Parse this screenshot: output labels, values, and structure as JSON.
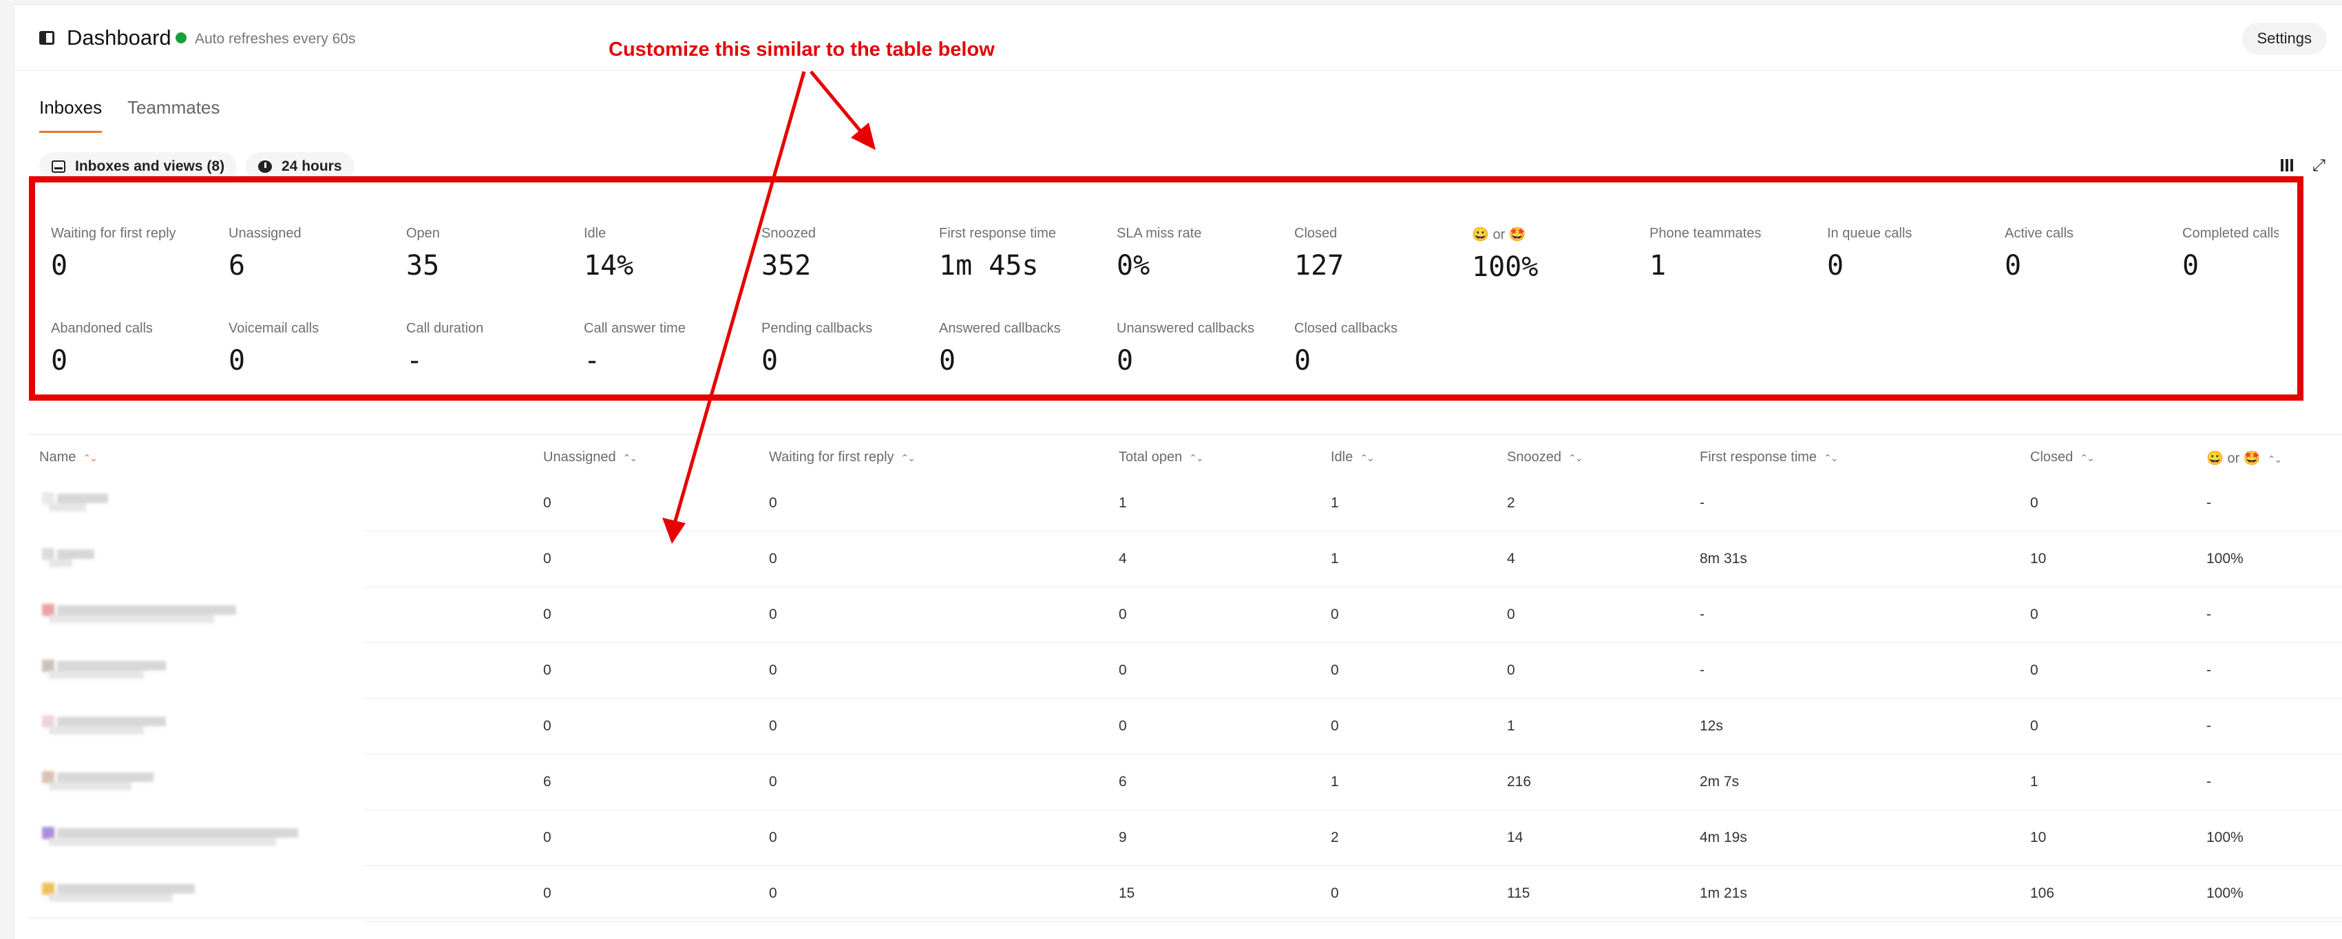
{
  "header": {
    "title": "Dashboard",
    "refresh_note": "Auto refreshes every 60s",
    "settings_label": "Settings"
  },
  "tabs": [
    {
      "label": "Inboxes",
      "active": true
    },
    {
      "label": "Teammates",
      "active": false
    }
  ],
  "filters": {
    "inboxes_label": "Inboxes and views (8)",
    "period_label": "24 hours"
  },
  "annotation": {
    "text": "Customize this similar to the table below",
    "color": "#e60000"
  },
  "metrics": [
    {
      "label": "Waiting for first reply",
      "value": "0"
    },
    {
      "label": "Unassigned",
      "value": "6"
    },
    {
      "label": "Open",
      "value": "35"
    },
    {
      "label": "Idle",
      "value": "14%"
    },
    {
      "label": "Snoozed",
      "value": "352"
    },
    {
      "label": "First response time",
      "value": "1m 45s"
    },
    {
      "label": "SLA miss rate",
      "value": "0%"
    },
    {
      "label": "Closed",
      "value": "127"
    },
    {
      "label": "😀 or 🤩",
      "value": "100%"
    },
    {
      "label": "Phone teammates",
      "value": "1"
    },
    {
      "label": "In queue calls",
      "value": "0"
    },
    {
      "label": "Active calls",
      "value": "0"
    },
    {
      "label": "Completed calls",
      "value": "0"
    },
    {
      "label": "Abandoned calls",
      "value": "0"
    },
    {
      "label": "Voicemail calls",
      "value": "0"
    },
    {
      "label": "Call duration",
      "value": "-"
    },
    {
      "label": "Call answer time",
      "value": "-"
    },
    {
      "label": "Pending callbacks",
      "value": "0"
    },
    {
      "label": "Answered callbacks",
      "value": "0"
    },
    {
      "label": "Unanswered callbacks",
      "value": "0"
    },
    {
      "label": "Closed callbacks",
      "value": "0"
    }
  ],
  "table": {
    "columns": [
      "Name",
      "Unassigned",
      "Waiting for first reply",
      "Total open",
      "Idle",
      "Snoozed",
      "First response time",
      "Closed",
      "😀 or 🤩"
    ],
    "rows": [
      {
        "swatch": "#e9e9e9",
        "cells": [
          "0",
          "0",
          "1",
          "1",
          "2",
          "-",
          "0",
          "-"
        ]
      },
      {
        "swatch": "#dcdcdc",
        "cells": [
          "0",
          "0",
          "4",
          "1",
          "4",
          "8m 31s",
          "10",
          "100%"
        ]
      },
      {
        "swatch": "#e8a4a4",
        "cells": [
          "0",
          "0",
          "0",
          "0",
          "0",
          "-",
          "0",
          "-"
        ]
      },
      {
        "swatch": "#c9c2bb",
        "cells": [
          "0",
          "0",
          "0",
          "0",
          "0",
          "-",
          "0",
          "-"
        ]
      },
      {
        "swatch": "#f2d2d6",
        "cells": [
          "0",
          "0",
          "0",
          "0",
          "1",
          "12s",
          "0",
          "-"
        ]
      },
      {
        "swatch": "#d9c3b6",
        "cells": [
          "6",
          "0",
          "6",
          "1",
          "216",
          "2m 7s",
          "1",
          "-"
        ]
      },
      {
        "swatch": "#a98fd9",
        "cells": [
          "0",
          "0",
          "9",
          "2",
          "14",
          "4m 19s",
          "10",
          "100%"
        ]
      },
      {
        "swatch": "#f0c060",
        "cells": [
          "0",
          "0",
          "15",
          "0",
          "115",
          "1m 21s",
          "106",
          "100%"
        ]
      }
    ]
  }
}
